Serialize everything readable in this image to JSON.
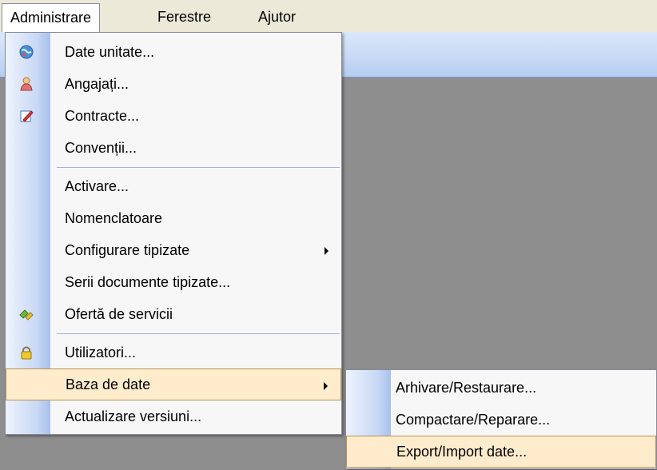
{
  "menubar": {
    "items": [
      {
        "label": "Administrare"
      },
      {
        "label": "Ferestre"
      },
      {
        "label": "Ajutor"
      }
    ]
  },
  "administrare_menu": {
    "items": [
      {
        "label": "Date unitate...",
        "icon": "globe-icon"
      },
      {
        "label": "Angajați...",
        "icon": "user-icon"
      },
      {
        "label": "Contracte...",
        "icon": "edit-document-icon"
      },
      {
        "label": "Convenții..."
      },
      {
        "label": "Activare..."
      },
      {
        "label": "Nomenclatoare"
      },
      {
        "label": "Configurare tipizate",
        "has_submenu": true
      },
      {
        "label": "Serii documente tipizate..."
      },
      {
        "label": "Ofertă de servicii",
        "icon": "services-icon"
      },
      {
        "label": "Utilizatori...",
        "icon": "lock-icon"
      },
      {
        "label": "Baza de date",
        "has_submenu": true,
        "highlighted": true
      },
      {
        "label": "Actualizare versiuni..."
      }
    ]
  },
  "baza_de_date_submenu": {
    "items": [
      {
        "label": "Arhivare/Restaurare..."
      },
      {
        "label": "Compactare/Reparare..."
      },
      {
        "label": "Export/Import date...",
        "highlighted": true
      }
    ]
  },
  "colors": {
    "highlight_bg": "#ffeccd",
    "highlight_border": "#b99252",
    "workspace": "#8e8e8e"
  }
}
